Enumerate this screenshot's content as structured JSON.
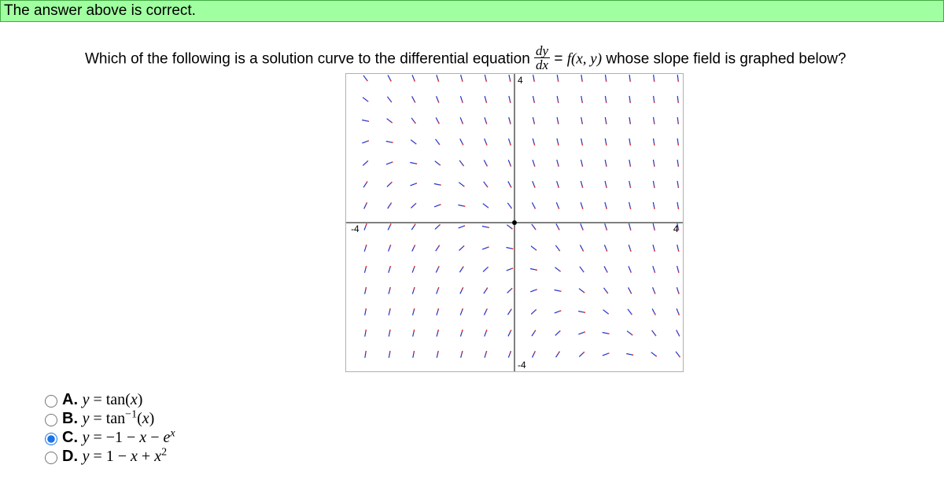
{
  "banner": "The answer above is correct.",
  "question": {
    "prefix": "Which of the following is a solution curve to the differential equation ",
    "frac_num": "dy",
    "frac_den": "dx",
    "middle": " = ",
    "func": "f(x, y)",
    "suffix": " whose slope field is graphed below?"
  },
  "axis": {
    "xmin": -4,
    "xmax": 4,
    "ymin": -4,
    "ymax": 4,
    "label_neg_x": "-4",
    "label_pos_x": "4",
    "label_pos_y": "4",
    "label_neg_y": "-4"
  },
  "chart_data": {
    "type": "vector-field",
    "description": "Slope field for dy/dx = f(x,y) on [-4,4]×[-4,4]. Segments in right half-plane are steep upward; left half-plane shows a diagonal band of near-horizontal slopes where y ≈ -1 - x, with steep upward slopes away from that band.",
    "x_range": [
      -4,
      4
    ],
    "y_range": [
      -4,
      4
    ],
    "grid_step": 0.5,
    "slope_rule": "slope ≈ -1 - x - y (near-horizontal along y = -1 - x; steep elsewhere)",
    "title": "",
    "xlabel": "",
    "ylabel": ""
  },
  "answers": [
    {
      "key": "A",
      "html": "<span class='var'>y</span> = tan(<span class='var'>x</span>)",
      "selected": false
    },
    {
      "key": "B",
      "html": "<span class='var'>y</span> = tan<sup>−1</sup>(<span class='var'>x</span>)",
      "selected": false
    },
    {
      "key": "C",
      "html": "<span class='var'>y</span> = −1 − <span class='var'>x</span> − <span class='var'>e</span><sup><span class='var'>x</span></sup>",
      "selected": true
    },
    {
      "key": "D",
      "html": "<span class='var'>y</span> = 1 − <span class='var'>x</span> + <span class='var'>x</span><sup>2</sup>",
      "selected": false
    }
  ]
}
